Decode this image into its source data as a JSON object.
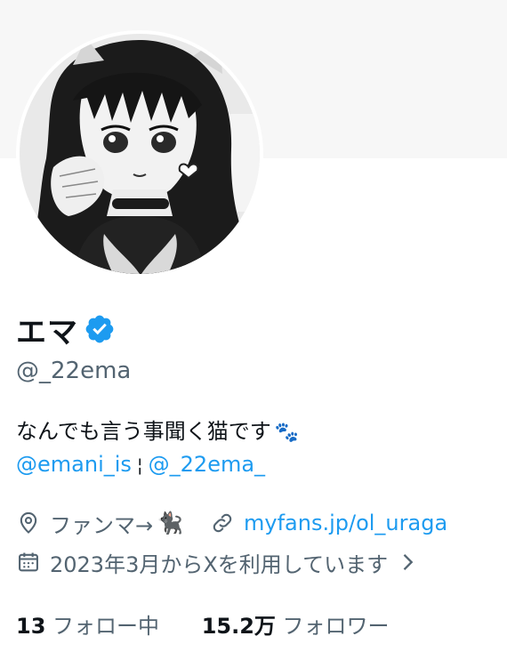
{
  "profile": {
    "display_name": "エマ",
    "handle": "@_22ema",
    "bio": "なんでも言う事聞く猫です",
    "bio_emoji": "🐾",
    "bio_mention_1": "@emani_is",
    "bio_separator": "¦",
    "bio_mention_2": "@_22ema_",
    "location": "ファンマ→",
    "location_emoji": "🐈‍⬛",
    "website": "myfans.jp/ol_uraga",
    "joined": "2023年3月からXを利用しています",
    "following_count": "13",
    "following_label": "フォロー中",
    "followers_count": "15.2万",
    "followers_label": "フォロワー"
  },
  "colors": {
    "accent": "#1d9bf0",
    "verified": "#1d9bf0",
    "secondary_text": "#536471",
    "primary_text": "#0f1419"
  },
  "icons": [
    "verified-badge-icon",
    "location-pin-icon",
    "link-icon",
    "calendar-icon",
    "chevron-right-icon"
  ]
}
